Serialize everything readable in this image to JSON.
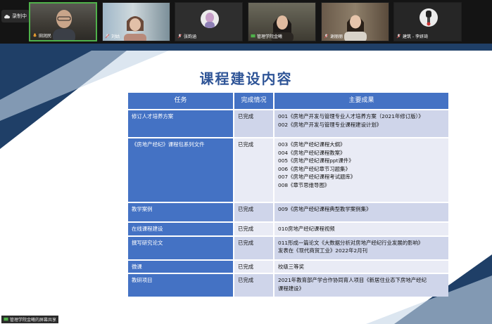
{
  "meeting": {
    "record_label": "录制中",
    "share_label": "管理学院金曦的屏幕共享",
    "participants": [
      {
        "name": "田润民"
      },
      {
        "name": "刘姑"
      },
      {
        "name": "张韵涵"
      },
      {
        "name": "管理学院金曦"
      },
      {
        "name": "谢丽丽"
      },
      {
        "name": "建筑 - 李妍琦"
      }
    ]
  },
  "slide": {
    "title": "课程建设内容",
    "headers": [
      "任务",
      "完成情况",
      "主要成果"
    ],
    "rows": [
      {
        "task": "修订人才培养方案",
        "status": "已完成",
        "results": [
          "001《房地产开发与管理专业人才培养方案（2021年修订版）》",
          "002《房地产开发与管理专业课程建设计划》"
        ]
      },
      {
        "task": "《房地产经纪》课程包系列文件",
        "status": "已完成",
        "results": [
          "003《房地产经纪课程大纲》",
          "004《房地产经纪课程教案》",
          "005《房地产经纪课程ppt课件》",
          "006《房地产经纪章节习题集》",
          "007《房地产经纪课程考试题库》",
          "008《章节思维导图》"
        ]
      },
      {
        "task": "教学案例",
        "status": "已完成",
        "results": [
          "009《房地产经纪课程典型教学案例集》"
        ]
      },
      {
        "task": "在线课程建设",
        "status": "已完成",
        "results": [
          "010房地产经纪课程视频"
        ]
      },
      {
        "task": "撰写研究论文",
        "status": "已完成",
        "results": [
          "011形成一篇论文《大数据分析对房地产经纪行业发展的影响》",
          "发表在《现代商贸工业》2022年2月刊"
        ]
      },
      {
        "task": "微课",
        "status": "已完成",
        "results": [
          "校级三等奖"
        ]
      },
      {
        "task": "教研项目",
        "status": "已完成",
        "results": [
          "2021年教育部产学合作协同育人项目《新居住业态下房地产经纪",
          "课程建设》"
        ]
      }
    ]
  },
  "colors": {
    "title": "#2f5597",
    "header_fill": "#4472c4",
    "row_light": "#cfd5ea",
    "row_pale": "#e9ebf5",
    "active_speaker_border": "#4fb14a",
    "slide_band": "#1f3f67"
  },
  "icons": [
    "cloud-record-icon",
    "mic-icon",
    "mic-muted-icon",
    "screen-share-icon"
  ]
}
